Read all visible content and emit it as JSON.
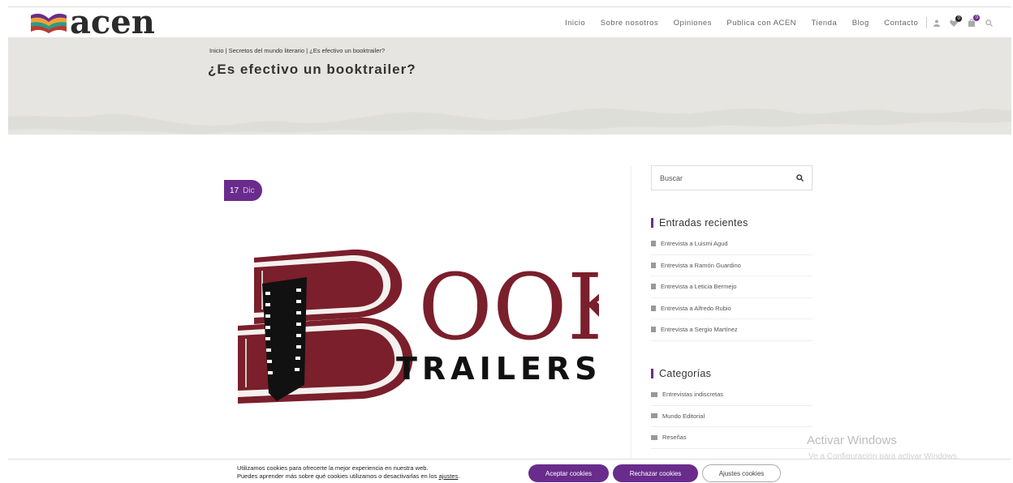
{
  "brand": {
    "name": "acen"
  },
  "nav": {
    "items": [
      "Inicio",
      "Sobre nosotros",
      "Opiniones",
      "Publica con ACEN",
      "Tienda",
      "Blog",
      "Contacto"
    ],
    "wishlist_count": "0",
    "cart_count": "0"
  },
  "hero": {
    "breadcrumb": "Inicio | Secretos del mundo literario | ¿Es efectivo un booktrailer?",
    "title": "¿Es efectivo un booktrailer?"
  },
  "post": {
    "day": "17",
    "month": "Dic",
    "image_text_main": "OOK",
    "image_text_sub": "TRAILERS"
  },
  "sidebar": {
    "search_placeholder": "Buscar",
    "recent_title": "Entradas recientes",
    "recent": [
      "Entrevista a Luismi Agud",
      "Entrevista a Ramón Guardino",
      "Entrevista a Leticia Bermejo",
      "Entrevista a Alfredo Rubio",
      "Entrevista a Sergio Martínez"
    ],
    "categories_title": "Categorías",
    "categories": [
      "Entrevistas indiscretas",
      "Mundo Editorial",
      "Reseñas"
    ]
  },
  "watermark": {
    "title": "Activar Windows",
    "subtitle": "Ve a Configuración para activar Windows."
  },
  "cookies": {
    "line1": "Utilizamos cookies para ofrecerte la mejor experiencia en nuestra web.",
    "line2": "Puedes aprender más sobre qué cookies utilizamos o desactivarlas en los",
    "link": "ajustes",
    "accept": "Aceptar cookies",
    "reject": "Rechazar cookies",
    "settings": "Ajustes cookies"
  },
  "colors": {
    "accent": "#6a2c8c",
    "book": "#7a1f2b",
    "hero_bg": "#e6e5e1"
  }
}
